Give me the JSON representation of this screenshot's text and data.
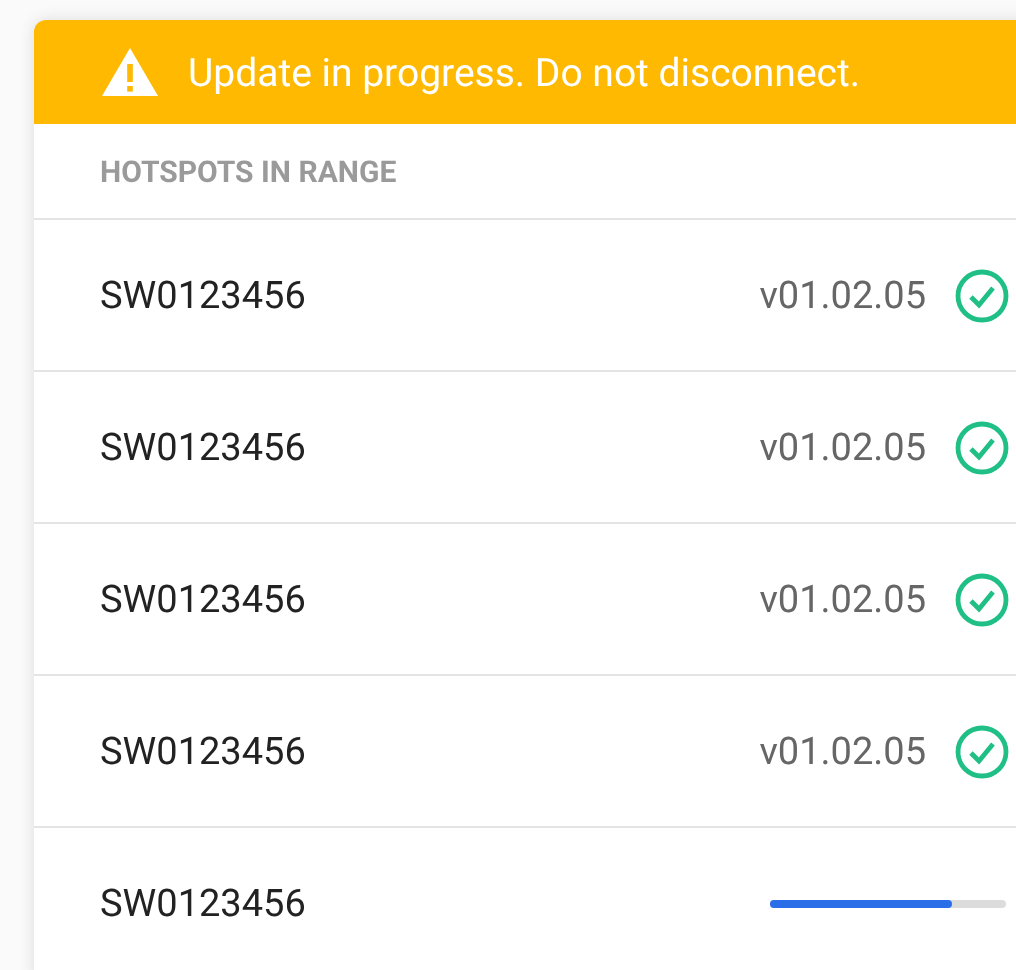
{
  "banner": {
    "message": "Update in progress. Do not disconnect."
  },
  "section": {
    "title": "HOTSPOTS IN RANGE"
  },
  "hotspots": [
    {
      "kind": "done",
      "name": "SW0123456",
      "version": "v01.02.05"
    },
    {
      "kind": "done",
      "name": "SW0123456",
      "version": "v01.02.05"
    },
    {
      "kind": "done",
      "name": "SW0123456",
      "version": "v01.02.05"
    },
    {
      "kind": "done",
      "name": "SW0123456",
      "version": "v01.02.05"
    },
    {
      "kind": "updating",
      "name": "SW0123456",
      "level": 0.77
    }
  ]
}
